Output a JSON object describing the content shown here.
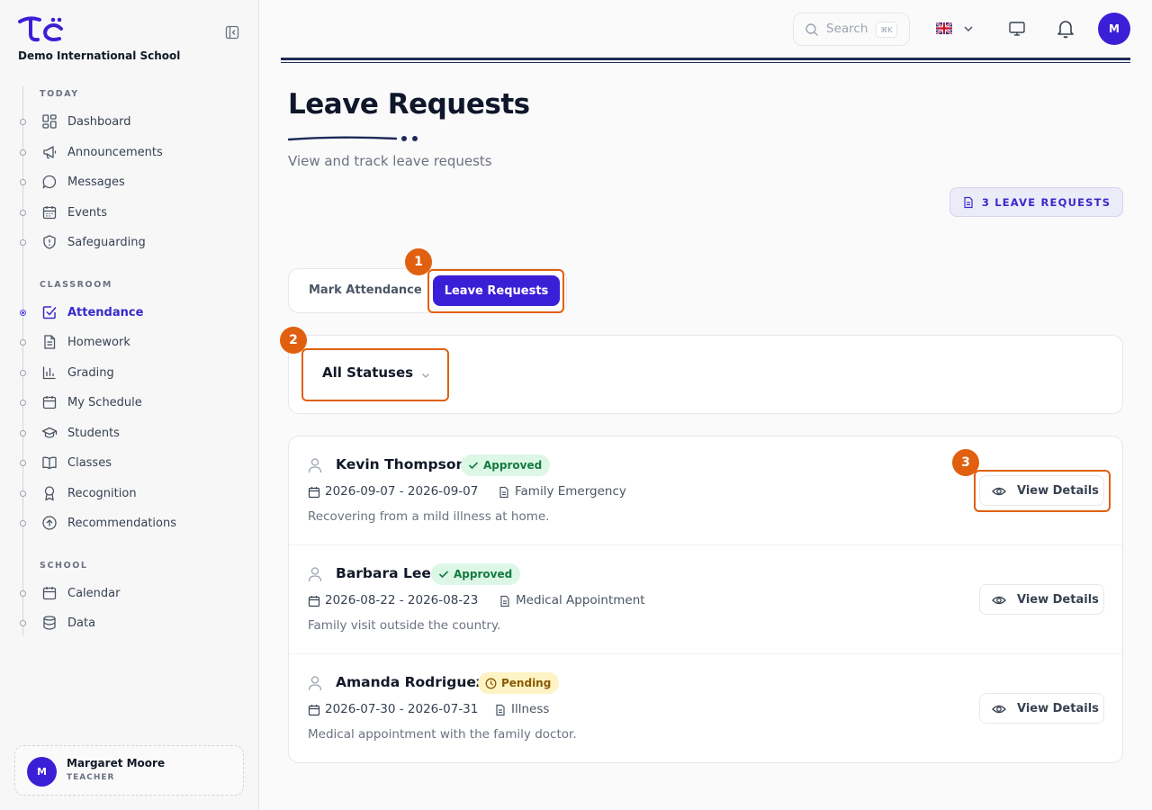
{
  "app": {
    "school_name": "Demo International School"
  },
  "sidebar": {
    "sections": [
      {
        "label": "TODAY"
      },
      {
        "label": "CLASSROOM"
      },
      {
        "label": "SCHOOL"
      }
    ],
    "items": [
      {
        "label": "Dashboard",
        "icon": "dashboard-icon"
      },
      {
        "label": "Announcements",
        "icon": "megaphone-icon"
      },
      {
        "label": "Messages",
        "icon": "message-icon"
      },
      {
        "label": "Events",
        "icon": "calendar-icon"
      },
      {
        "label": "Safeguarding",
        "icon": "shield-icon"
      },
      {
        "label": "Attendance",
        "icon": "checkbox-icon",
        "active": true
      },
      {
        "label": "Homework",
        "icon": "document-icon"
      },
      {
        "label": "Grading",
        "icon": "bar-chart-icon"
      },
      {
        "label": "My Schedule",
        "icon": "calendar-icon"
      },
      {
        "label": "Students",
        "icon": "graduation-cap-icon"
      },
      {
        "label": "Classes",
        "icon": "book-icon"
      },
      {
        "label": "Recognition",
        "icon": "award-icon"
      },
      {
        "label": "Recommendations",
        "icon": "arrow-up-circle-icon"
      },
      {
        "label": "Calendar",
        "icon": "calendar-icon"
      },
      {
        "label": "Data",
        "icon": "database-icon"
      }
    ],
    "user": {
      "initial": "M",
      "name": "Margaret Moore",
      "role": "TEACHER"
    }
  },
  "topbar": {
    "search_placeholder": "Search",
    "shortcut": "⌘K",
    "avatar_initial": "M"
  },
  "header": {
    "title": "Leave Requests",
    "subtitle": "View and track leave requests",
    "count_badge": "3 LEAVE REQUESTS"
  },
  "tabs": {
    "mark_attendance": "Mark Attendance",
    "leave_requests": "Leave Requests"
  },
  "filter": {
    "status_value": "All Statuses"
  },
  "requests": [
    {
      "name": "Kevin Thompson",
      "status": "Approved",
      "dates": "2026-09-07 - 2026-09-07",
      "type": "Family Emergency",
      "reason": "Recovering from a mild illness at home.",
      "action": "View Details"
    },
    {
      "name": "Barbara Lee",
      "status": "Approved",
      "dates": "2026-08-22 - 2026-08-23",
      "type": "Medical Appointment",
      "reason": "Family visit outside the country.",
      "action": "View Details"
    },
    {
      "name": "Amanda Rodriguez",
      "status": "Pending",
      "dates": "2026-07-30 - 2026-07-31",
      "type": "Illness",
      "reason": "Medical appointment with the family doctor.",
      "action": "View Details"
    }
  ],
  "annotations": [
    "1",
    "2",
    "3"
  ],
  "colors": {
    "brand": "#3b1fd6",
    "annotation": "#e0600f",
    "approved_bg": "#dcf7e6",
    "pending_bg": "#fdf3c4"
  }
}
